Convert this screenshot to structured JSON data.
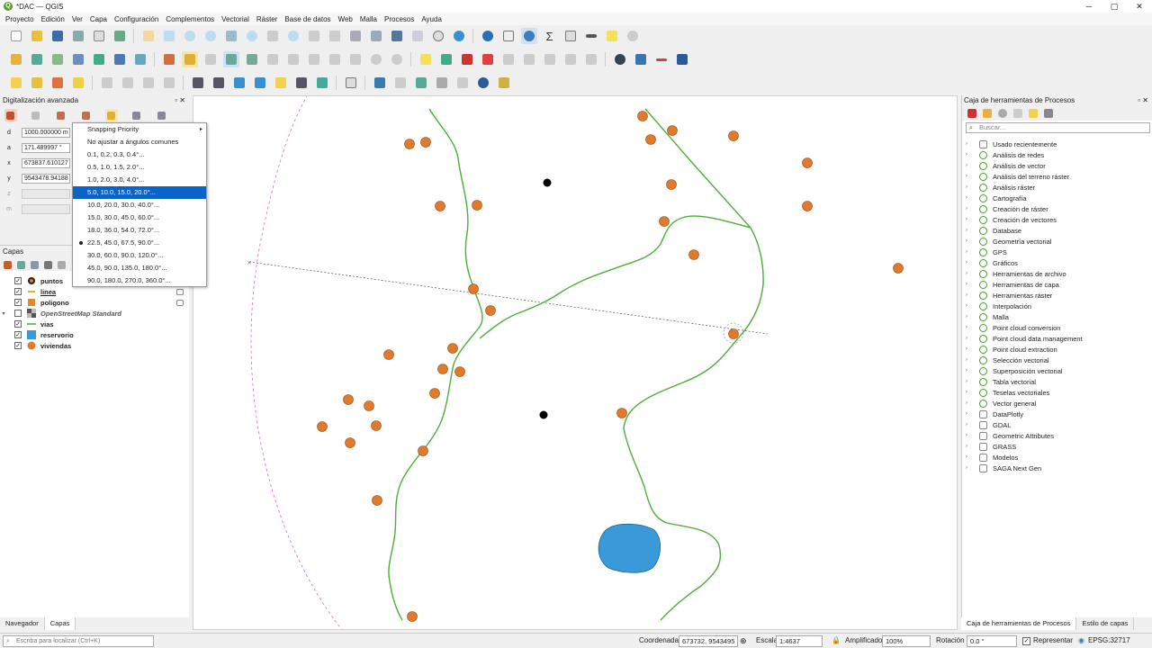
{
  "window": {
    "title": "*DAC — QGIS"
  },
  "menu": [
    "Proyecto",
    "Edición",
    "Ver",
    "Capa",
    "Configuración",
    "Complementos",
    "Vectorial",
    "Ráster",
    "Base de datos",
    "Web",
    "Malla",
    "Procesos",
    "Ayuda"
  ],
  "advanced_digitizing": {
    "title": "Digitalización avanzada",
    "fields": {
      "d": "1000.000000 m",
      "a": "171.489997 °",
      "x": "673837.610127",
      "y": "9543478.94188",
      "z": "",
      "m": ""
    },
    "labels": {
      "d": "d",
      "a": "a",
      "x": "x",
      "y": "y",
      "z": "z",
      "m": "m"
    }
  },
  "snap_menu": {
    "items": [
      {
        "label": "Snapping Priority",
        "submenu": true
      },
      {
        "label": "No ajustar a ángulos comunes"
      },
      {
        "label": "0.1, 0.2, 0.3, 0.4°..."
      },
      {
        "label": "0.5, 1.0, 1.5, 2.0°..."
      },
      {
        "label": "1.0, 2.0, 3.0, 4.0°..."
      },
      {
        "label": "5.0, 10.0, 15.0, 20.0°...",
        "highlighted": true
      },
      {
        "label": "10.0, 20.0, 30.0, 40.0°..."
      },
      {
        "label": "15.0, 30.0, 45.0, 60.0°..."
      },
      {
        "label": "18.0, 36.0, 54.0, 72.0°..."
      },
      {
        "label": "22.5, 45.0, 67.5, 90.0°...",
        "checked": true
      },
      {
        "label": "30.0, 60.0, 90.0, 120.0°..."
      },
      {
        "label": "45.0, 90.0, 135.0, 180.0°..."
      },
      {
        "label": "90.0, 180.0, 270.0, 360.0°..."
      }
    ]
  },
  "layers": {
    "title": "Capas",
    "items": [
      {
        "name": "puntos",
        "checked": true,
        "bold": true
      },
      {
        "name": "linea",
        "checked": true,
        "bold": true
      },
      {
        "name": "poligono",
        "checked": true,
        "bold": true
      },
      {
        "name": "OpenStreetMap Standard",
        "checked": false,
        "italic": true,
        "group": true
      },
      {
        "name": "vias",
        "checked": true,
        "bold": true
      },
      {
        "name": "reservorio",
        "checked": true,
        "bold": true
      },
      {
        "name": "viviendas",
        "checked": true,
        "bold": true
      }
    ]
  },
  "left_tabs": [
    "Navegador",
    "Capas"
  ],
  "processing": {
    "title": "Caja de herramientas de Procesos",
    "search_placeholder": "Buscar...",
    "items": [
      "Usado recientemente",
      "Análisis de redes",
      "Análisis de vector",
      "Análisis del terreno ráster",
      "Análisis ráster",
      "Cartografía",
      "Creación de ráster",
      "Creación de vectores",
      "Database",
      "Geometría vectorial",
      "GPS",
      "Gráficos",
      "Herramientas de archivo",
      "Herramientas de capa",
      "Herramientas ráster",
      "Interpolación",
      "Malla",
      "Point cloud conversion",
      "Point cloud data management",
      "Point cloud extraction",
      "Selección vectorial",
      "Superposición vectorial",
      "Tabla vectorial",
      "Teselas vectoriales",
      "Vector general",
      "DataPlotly",
      "GDAL",
      "Geometric Attributes",
      "GRASS",
      "Modelos",
      "SAGA Next Gen"
    ]
  },
  "right_tabs": [
    "Caja de herramientas de Procesos",
    "Estilo de capas"
  ],
  "status": {
    "locator_placeholder": "Escriba para localizar (Ctrl+K)",
    "coord_label": "Coordenada",
    "coord_value": "673732, 9543495",
    "scale_label": "Escala",
    "scale_value": "1:4637",
    "magnifier_label": "Amplificador",
    "magnifier_value": "100%",
    "rotation_label": "Rotación",
    "rotation_value": "0.0 °",
    "render_label": "Representar",
    "crs": "EPSG:32717"
  },
  "colors": {
    "point_fill": "#e07a2c",
    "line": "#4fad3a",
    "polygon": "#3a9ad9",
    "highlight": "#0a64c8"
  }
}
